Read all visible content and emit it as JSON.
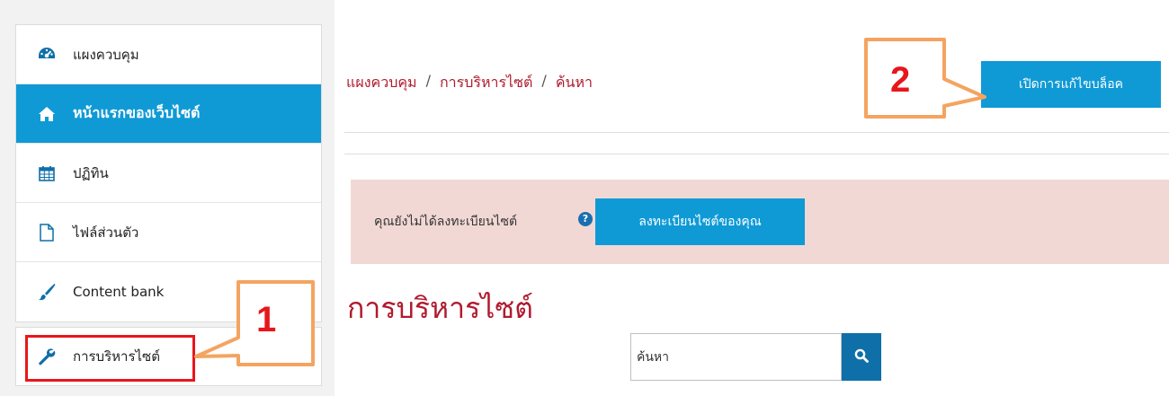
{
  "sidebar": {
    "items": [
      {
        "label": "แผงควบคุม",
        "icon": "dashboard-icon",
        "active": false
      },
      {
        "label": "หน้าแรกของเว็บไซต์",
        "icon": "home-icon",
        "active": true
      },
      {
        "label": "ปฏิทิน",
        "icon": "calendar-icon",
        "active": false
      },
      {
        "label": "ไฟล์ส่วนตัว",
        "icon": "file-icon",
        "active": false
      },
      {
        "label": "Content bank",
        "icon": "paintbrush-icon",
        "active": false
      }
    ],
    "admin_item": {
      "label": "การบริหารไซต์",
      "icon": "wrench-icon"
    }
  },
  "breadcrumb": {
    "items": [
      "แผงควบคุม",
      "การบริหารไซต์",
      "ค้นหา"
    ],
    "separator": "/"
  },
  "header": {
    "edit_button_label": "เปิดการแก้ไขบล็อค"
  },
  "alert": {
    "message": "คุณยังไม่ได้ลงทะเบียนไซต์",
    "register_button_label": "ลงทะเบียนไซต์ของคุณ",
    "help_icon": "question-circle-icon"
  },
  "main": {
    "heading": "การบริหารไซต์",
    "search": {
      "value": "ค้นหา",
      "button_icon": "search-icon"
    }
  },
  "annotations": {
    "callout_1": "1",
    "callout_2": "2"
  },
  "colors": {
    "accent": "#0f9ad6",
    "link": "#b01b2e",
    "alert_bg": "#f2d8d5",
    "callout_border": "#f4a460",
    "callout_number": "#e8161b",
    "highlight_frame": "#e8161b"
  }
}
